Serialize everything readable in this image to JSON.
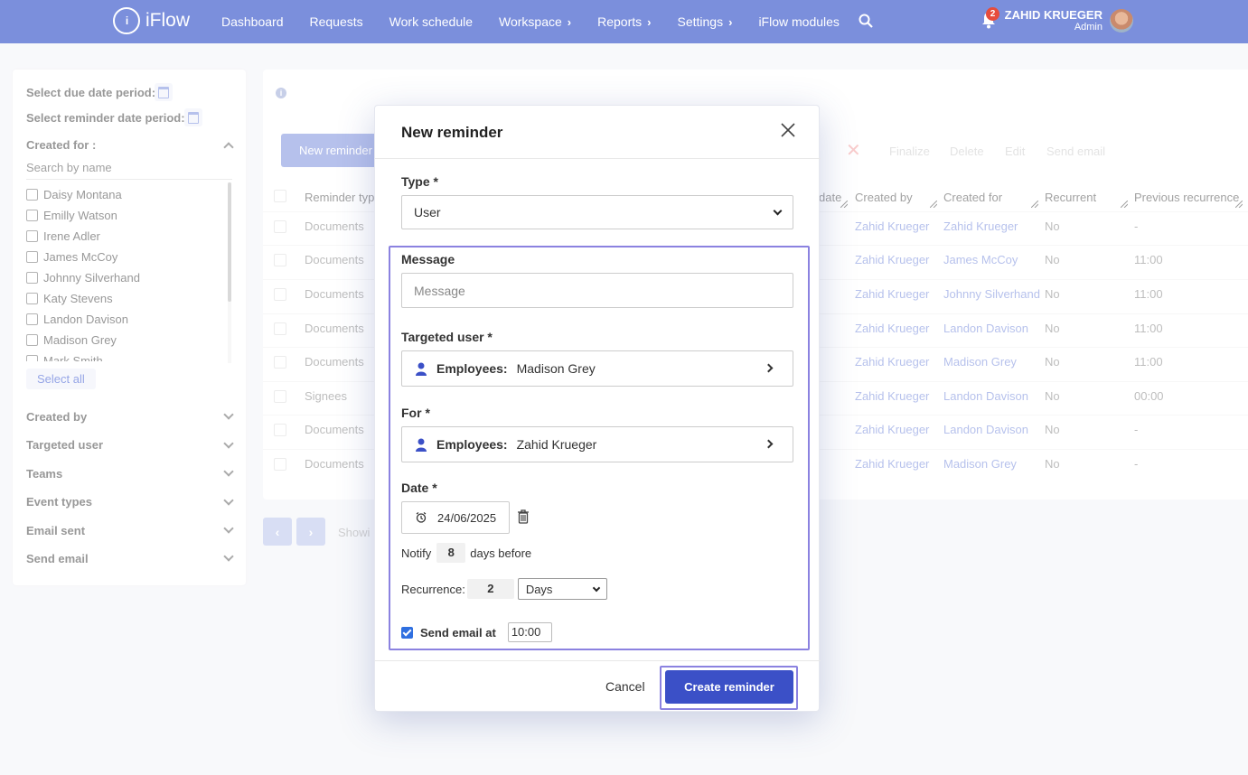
{
  "app": {
    "logo_text": "iFlow",
    "logo_mark": "i"
  },
  "nav": [
    {
      "label": "Dashboard",
      "chevron": false
    },
    {
      "label": "Requests",
      "chevron": false
    },
    {
      "label": "Work schedule",
      "chevron": false
    },
    {
      "label": "Workspace",
      "chevron": true
    },
    {
      "label": "Reports",
      "chevron": true
    },
    {
      "label": "Settings",
      "chevron": true
    },
    {
      "label": "iFlow modules",
      "chevron": false
    }
  ],
  "user": {
    "name": "ZAHID KRUEGER",
    "role": "Admin",
    "notifications": "2"
  },
  "filters": {
    "due_date_label": "Select due date period:",
    "reminder_date_label": "Select reminder date period:",
    "created_for_label": "Created for :",
    "search_placeholder": "Search by name",
    "names": [
      "Daisy Montana",
      "Emilly Watson",
      "Irene Adler",
      "James McCoy",
      "Johnny Silverhand",
      "Katy Stevens",
      "Landon Davison",
      "Madison Grey",
      "Mark Smith"
    ],
    "select_all": "Select all",
    "sections": [
      "Created by",
      "Targeted user",
      "Teams",
      "Event types",
      "Email sent",
      "Send email"
    ]
  },
  "toolbar": {
    "new_reminder": "New reminder",
    "actions": [
      "Finalize",
      "Delete",
      "Edit",
      "Send email"
    ]
  },
  "table": {
    "headers": [
      "Reminder typ",
      "date",
      "Created by",
      "Created for",
      "Recurrent",
      "Previous recurrence"
    ],
    "rows": [
      {
        "type": "Documents",
        "created_by": "Zahid Krueger",
        "created_for": "Zahid Krueger",
        "recurrent": "No",
        "previous": "-"
      },
      {
        "type": "Documents",
        "created_by": "Zahid Krueger",
        "created_for": "James McCoy",
        "recurrent": "No",
        "previous": "11:00"
      },
      {
        "type": "Documents",
        "created_by": "Zahid Krueger",
        "created_for": "Johnny Silverhand",
        "recurrent": "No",
        "previous": "11:00"
      },
      {
        "type": "Documents",
        "created_by": "Zahid Krueger",
        "created_for": "Landon Davison",
        "recurrent": "No",
        "previous": "11:00"
      },
      {
        "type": "Documents",
        "created_by": "Zahid Krueger",
        "created_for": "Madison Grey",
        "recurrent": "No",
        "previous": "11:00"
      },
      {
        "type": "Signees",
        "created_by": "Zahid Krueger",
        "created_for": "Landon Davison",
        "recurrent": "No",
        "previous": "00:00"
      },
      {
        "type": "Documents",
        "created_by": "Zahid Krueger",
        "created_for": "Landon Davison",
        "recurrent": "No",
        "previous": "-"
      },
      {
        "type": "Documents",
        "created_by": "Zahid Krueger",
        "created_for": "Madison Grey",
        "recurrent": "No",
        "previous": "-"
      }
    ],
    "showing": "Showi"
  },
  "modal": {
    "title": "New reminder",
    "type_label": "Type *",
    "type_value": "User",
    "message_label": "Message",
    "message_placeholder": "Message",
    "targeted_label": "Targeted user *",
    "targeted_kind": "Employees:",
    "targeted_value": "Madison Grey",
    "for_label": "For *",
    "for_kind": "Employees:",
    "for_value": "Zahid Krueger",
    "date_label": "Date *",
    "date_value": "24/06/2025",
    "notify_prefix": "Notify",
    "notify_value": "8",
    "notify_suffix": "days before",
    "recurrence_label": "Recurrence:",
    "recurrence_value": "2",
    "recurrence_unit": "Days",
    "send_email_label": "Send email at",
    "send_email_time": "10:00",
    "cancel": "Cancel",
    "create": "Create reminder"
  }
}
